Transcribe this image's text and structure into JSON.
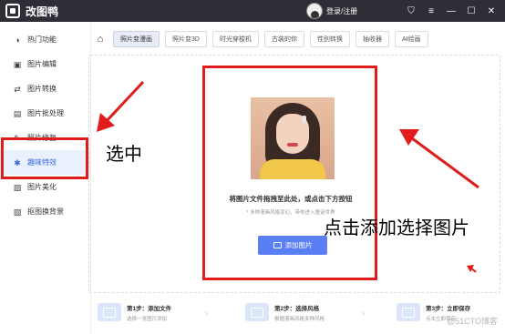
{
  "app": {
    "title": "改图鸭",
    "login_text": "登录/注册",
    "window_controls": {
      "shirt": "⛉",
      "menu": "≡",
      "minimize": "—",
      "maximize": "☐",
      "close": "✕"
    }
  },
  "sidebar": {
    "items": [
      {
        "label": "热门功能",
        "icon": "hot-icon",
        "glyph": "◑"
      },
      {
        "label": "图片编辑",
        "icon": "image-edit-icon",
        "glyph": "▣"
      },
      {
        "label": "图片转换",
        "icon": "image-convert-icon",
        "glyph": "⇄"
      },
      {
        "label": "图片批处理",
        "icon": "batch-icon",
        "glyph": "▤"
      },
      {
        "label": "照片修复",
        "icon": "repair-icon",
        "glyph": "✎"
      },
      {
        "label": "趣味特效",
        "icon": "magic-icon",
        "glyph": "✱",
        "active": true
      },
      {
        "label": "图片美化",
        "icon": "beautify-icon",
        "glyph": "▨"
      },
      {
        "label": "抠图换背景",
        "icon": "cutout-icon",
        "glyph": "▧"
      }
    ]
  },
  "tabs": [
    {
      "label": "照片变漫画",
      "active": true
    },
    {
      "label": "照片变3D"
    },
    {
      "label": "时光穿梭机"
    },
    {
      "label": "古装的你"
    },
    {
      "label": "性别转换"
    },
    {
      "label": "抽收器"
    },
    {
      "label": "AI绘画"
    }
  ],
  "upload": {
    "main_text": "将图片文件拖拽至此处，或点击下方按钮",
    "sub_text": "* 多种漫画风格变幻，带你进入童话世界",
    "add_button": "添加图片"
  },
  "annotations": {
    "select_label": "选中",
    "add_label": "点击添加选择图片"
  },
  "steps": [
    {
      "title": "第1步：添加文件",
      "desc": "选择一张图片添加"
    },
    {
      "title": "第2步：选择风格",
      "desc": "根据漫画风格多种风格"
    },
    {
      "title": "第3步：立即保存",
      "desc": "点击立即保存"
    }
  ],
  "watermark": "@51CTO博客",
  "colors": {
    "accent": "#5a7ff5",
    "annotation": "#e01c1c",
    "titlebar": "#2e2f36"
  }
}
